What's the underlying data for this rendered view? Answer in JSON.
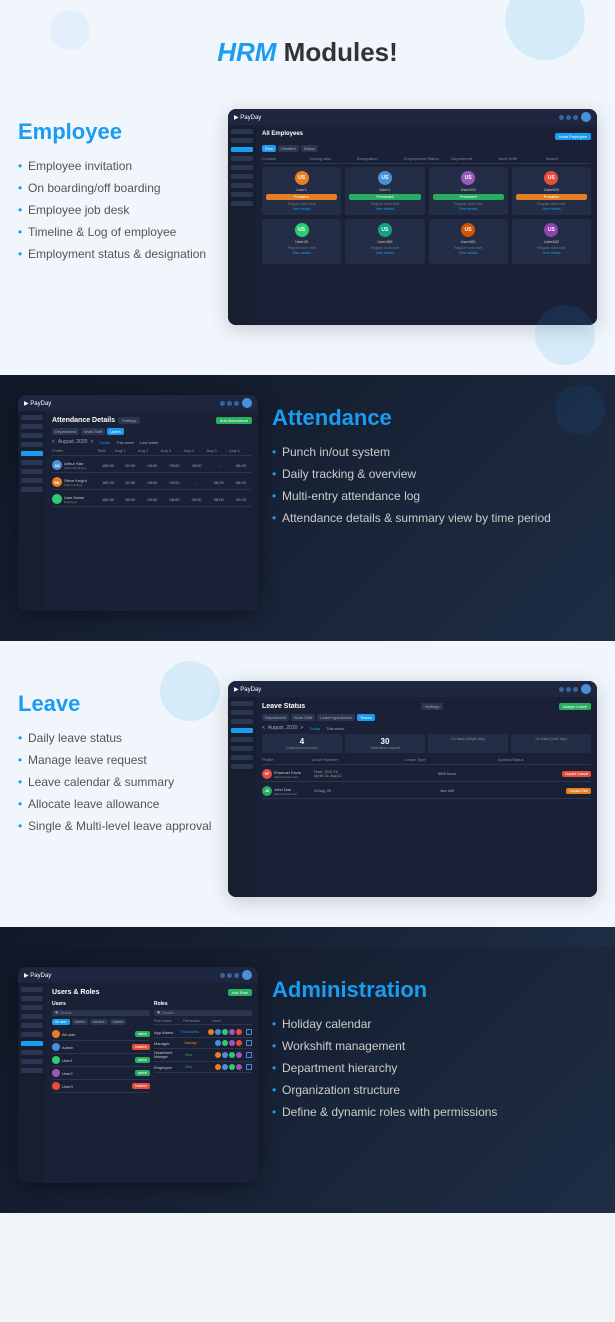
{
  "header": {
    "title_italic": "HRM",
    "title_rest": " Modules!"
  },
  "employee": {
    "heading": "Employee",
    "features": [
      "Employee invitation",
      "On boarding/off boarding",
      "Employee job desk",
      "Timeline & Log of employee",
      "Employment status & designation"
    ],
    "screenshot": {
      "logo": "PayDay",
      "page_title": "All Employees",
      "invite_btn": "Invite Employee",
      "tabs": [
        "Row",
        "Detailed",
        "Salary"
      ],
      "headers": [
        "Created",
        "Joining date",
        "Designation",
        "Employment Status",
        "Department",
        "Work Shift"
      ],
      "cards": [
        {
          "initials": "US",
          "name": "User1",
          "status": "Permanent",
          "shift": "Regular work shift",
          "color": "#e67e22"
        },
        {
          "initials": "US",
          "name": "User1",
          "status": "Permanent",
          "shift": "Regular work shift",
          "color": "#4a90d9"
        },
        {
          "initials": "US",
          "name": "User100",
          "status": "Permanent",
          "shift": "Regular work shift",
          "color": "#9b59b6"
        },
        {
          "initials": "US",
          "name": "User400",
          "status": "Probation",
          "shift": "Regular work shift",
          "color": "#e74c3c"
        }
      ]
    }
  },
  "attendance": {
    "heading": "Attendance",
    "features": [
      "Punch in/out system",
      "Daily tracking & overview",
      "Multi-entry attendance log",
      "Attendance details & summary view by time period"
    ],
    "screenshot": {
      "logo": "PayDay",
      "page_title": "Attendance Details",
      "settings_btn": "Settings",
      "add_btn": "Add Attendance",
      "tabs": [
        "Department",
        "Work Shift",
        "Users"
      ],
      "month": "August, 2020",
      "columns": [
        "Profile",
        "Total",
        "Aug 1",
        "Aug 2",
        "Aug 3",
        "Aug 4",
        "Aug 5",
        "Aug 6",
        "Aug 7"
      ],
      "rows": [
        {
          "name": "Arthur Star",
          "role": "Admin Employee",
          "total": "185:00",
          "times": [
            "09:00",
            "08:00",
            "09:00",
            "08:00",
            "--",
            "08:00"
          ]
        },
        {
          "name": "Steve Knight",
          "role": "Admin & Emp",
          "total": "185:00",
          "times": [
            "09:00",
            "08:00",
            "09:00",
            "08:00",
            "--",
            "08:00"
          ],
          "highlight": true
        }
      ]
    }
  },
  "leave": {
    "heading": "Leave",
    "features": [
      "Daily leave status",
      "Manage leave request",
      "Leave calendar & summary",
      "Allocate leave allowance",
      "Single & Multi-level leave approval"
    ],
    "screenshot": {
      "logo": "PayDay",
      "page_title": "Leave Status",
      "settings_btn": "Settings",
      "assign_btn": "Assign Leave",
      "tabs": [
        "Department",
        "Work Shift",
        "Leave type/Action",
        "Teams"
      ],
      "month": "August, 2020",
      "stats": [
        {
          "num": "4",
          "label": "Employees on leave"
        },
        {
          "num": "30",
          "label": "Total leave request"
        },
        {
          "num": "",
          "label": "On leave (Single day)"
        },
        {
          "num": "",
          "label": "On leave (multi day)"
        }
      ],
      "rows": [
        {
          "name": "Emanuel Favre",
          "dates": "From: 12/11 Fri\nUp till: 14, Aug 21",
          "duration": "8500 Hours",
          "type": "half-half",
          "leave_type": "Unpaid Casual",
          "color": "#e74c3c"
        },
        {
          "name": "",
          "dates": "19 Aug, 25",
          "duration": "4am half",
          "type": "",
          "leave_type": "Unpaid Sick",
          "color": "#e67e22"
        }
      ]
    }
  },
  "administration": {
    "heading": "Administration",
    "features": [
      "Holiday calendar",
      "Workshift management",
      "Department hierarchy",
      "Organization structure",
      "Define & dynamic roles with permissions"
    ],
    "screenshot": {
      "logo": "PayDay",
      "page_title": "Users & Roles",
      "add_btn": "Add Role",
      "sections": {
        "users": {
          "title": "Users",
          "search_placeholder": "Search",
          "rows": [
            {
              "name": "All user",
              "status": "active",
              "color": "#27ae60"
            },
            {
              "name": "Admin",
              "status": "inactive",
              "color": "#e74c3c"
            },
            {
              "name": "User1",
              "status": "active",
              "color": "#27ae60"
            },
            {
              "name": "User2",
              "status": "active",
              "color": "#27ae60"
            },
            {
              "name": "User3",
              "status": "inactive",
              "color": "#e74c3c"
            }
          ]
        },
        "roles": {
          "title": "Roles",
          "search_placeholder": "Search",
          "rows": [
            {
              "name": "App Admin",
              "permission": "Full Acess",
              "users": 5
            },
            {
              "name": "Manager",
              "permission": "Manage",
              "users": 4
            },
            {
              "name": "Department Manager",
              "permission": "View",
              "users": 4
            },
            {
              "name": "Employee",
              "permission": "View",
              "users": 4
            }
          ]
        }
      }
    }
  }
}
